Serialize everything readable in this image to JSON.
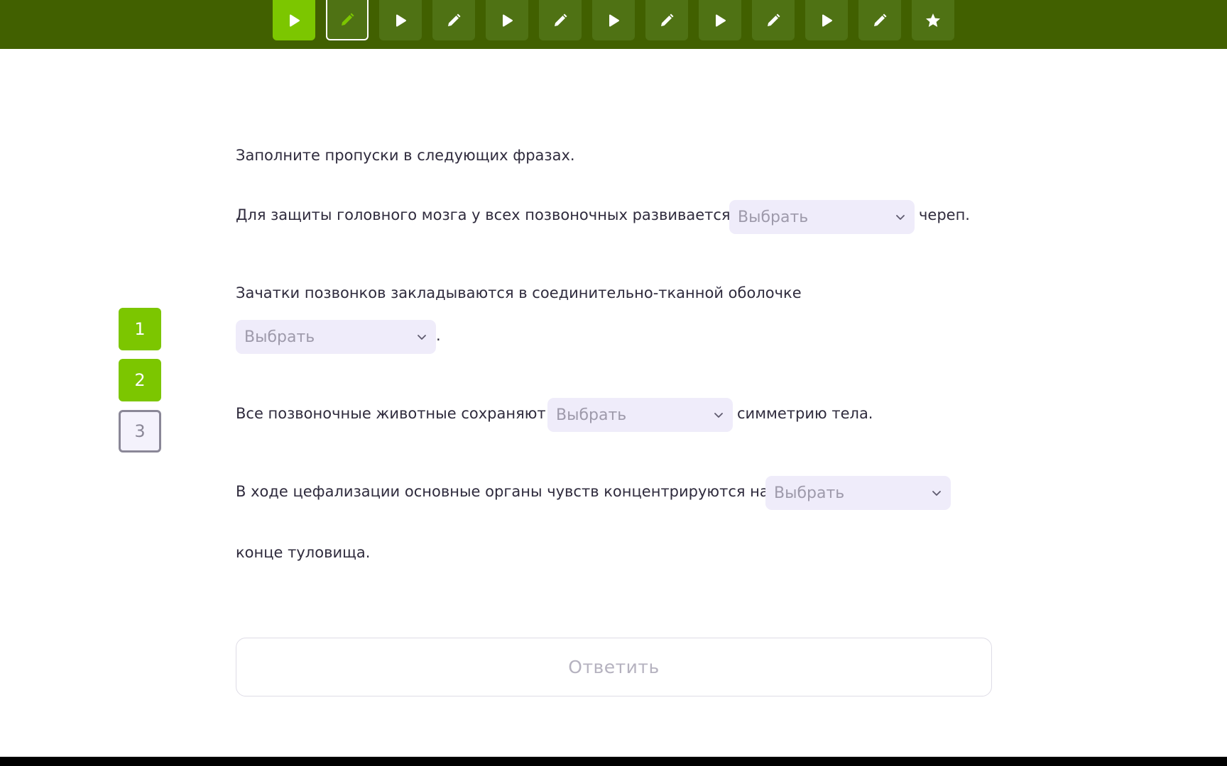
{
  "nav": {
    "steps": [
      {
        "icon": "play-icon",
        "state": "active"
      },
      {
        "icon": "pencil-icon",
        "state": "current"
      },
      {
        "icon": "play-icon",
        "state": "normal"
      },
      {
        "icon": "pencil-icon",
        "state": "normal"
      },
      {
        "icon": "play-icon",
        "state": "normal"
      },
      {
        "icon": "pencil-icon",
        "state": "normal"
      },
      {
        "icon": "play-icon",
        "state": "normal"
      },
      {
        "icon": "pencil-icon",
        "state": "normal"
      },
      {
        "icon": "play-icon",
        "state": "normal"
      },
      {
        "icon": "pencil-icon",
        "state": "normal"
      },
      {
        "icon": "play-icon",
        "state": "normal"
      },
      {
        "icon": "pencil-icon",
        "state": "normal"
      },
      {
        "icon": "star-icon",
        "state": "normal"
      }
    ]
  },
  "tasks": [
    {
      "label": "1",
      "state": "done"
    },
    {
      "label": "2",
      "state": "done"
    },
    {
      "label": "3",
      "state": "pending"
    }
  ],
  "exercise": {
    "instruction": "Заполните пропуски в следующих фразах.",
    "q1": {
      "before": "Для защиты головного мозга у всех позвоночных развивается",
      "placeholder": "Выбрать",
      "after": "череп."
    },
    "q2": {
      "before": "Зачатки позвонков закладываются в соединительно-тканной оболочке",
      "placeholder": "Выбрать",
      "after": "."
    },
    "q3": {
      "before": "Все позвоночные животные сохраняют",
      "placeholder": "Выбрать",
      "after": "симметрию тела."
    },
    "q4": {
      "before": "В ходе цефализации основные органы чувств концентрируются на",
      "placeholder": "Выбрать",
      "after": "конце туловища."
    }
  },
  "answer_button": "Ответить",
  "colors": {
    "topbar": "#416000",
    "step": "#4f7214",
    "accent": "#7cc600",
    "select_bg": "#efecfa"
  }
}
